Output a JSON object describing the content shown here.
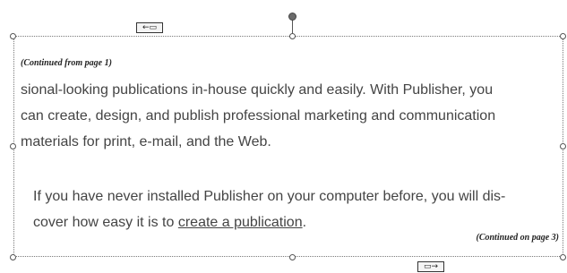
{
  "text_frame": {
    "continued_from": "(Continued from page 1)",
    "paragraph1_lines": [
      "sional-looking publications in-house quickly and easily. With Publisher, you",
      "can create, design, and publish professional marketing and communication",
      "materials for print, e-mail, and the Web."
    ],
    "paragraph2_lines": [
      "If you have never installed Publisher on your computer before, you will dis-",
      "cover how easy it is to "
    ],
    "link_text": "create a publication",
    "paragraph2_end": ".",
    "continued_on": "(Continued on page 3)"
  },
  "icons": {
    "previous_frame": "previous-text-box-icon",
    "next_frame": "next-text-box-icon",
    "rotate": "rotate-handle-icon"
  },
  "colors": {
    "text": "#444444",
    "border": "#7a7a7a"
  }
}
